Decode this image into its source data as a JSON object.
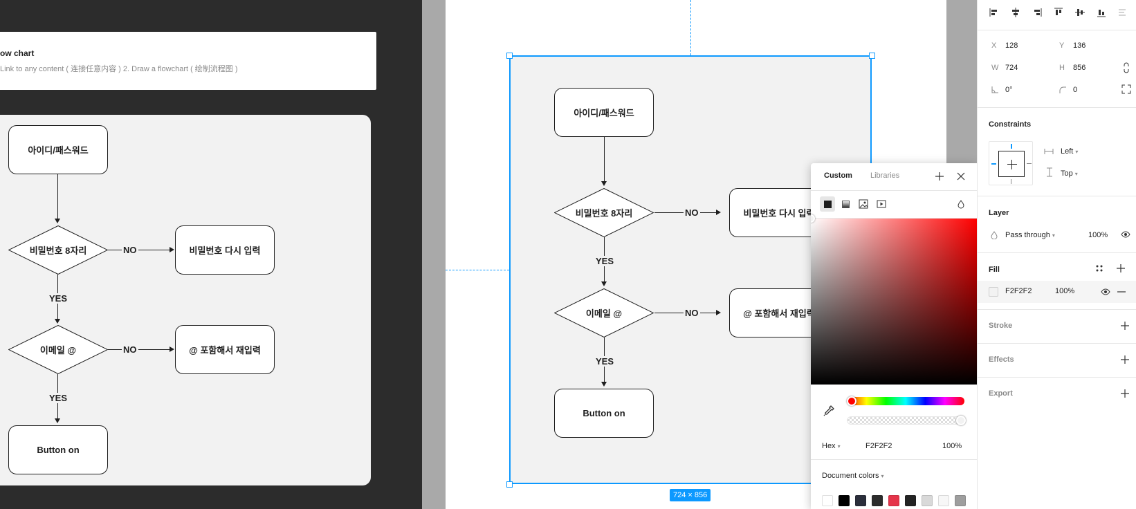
{
  "left_canvas": {
    "note_title": "ow chart",
    "note_subtitle": "Link to any content ( 连接任意内容 ) 2. Draw a flowchart ( 绘制流程图 )"
  },
  "flowchart": {
    "node_id_password": "아이디/패스워드",
    "node_pw_check": "비밀번호 8자리",
    "node_pw_retry": "비밀번호 다시 입력",
    "node_email_check": "이메일 @",
    "node_email_retry": "@ 포함해서 재입력",
    "node_button_on": "Button on",
    "label_no": "NO",
    "label_yes": "YES"
  },
  "selection": {
    "size_label": "724 × 856"
  },
  "color_picker": {
    "tab_custom": "Custom",
    "tab_libraries": "Libraries",
    "mode": "Hex",
    "hex_value": "F2F2F2",
    "opacity": "100%",
    "document_colors_label": "Document colors",
    "document_colors": [
      "#ffffff",
      "#000000",
      "#2b2e3b",
      "#2c2c2c",
      "#e5344a",
      "#232323",
      "#d9d9d9",
      "#f7f7f7",
      "#9e9e9e"
    ],
    "icons": [
      "solid-fill-icon",
      "gradient-fill-icon",
      "image-fill-icon",
      "video-fill-icon",
      "blend-mode-icon",
      "plus-icon",
      "close-icon",
      "eyedropper-icon"
    ]
  },
  "properties": {
    "x_label": "X",
    "x_value": "128",
    "y_label": "Y",
    "y_value": "136",
    "w_label": "W",
    "w_value": "724",
    "h_label": "H",
    "h_value": "856",
    "rotation_value": "0°",
    "corner_radius_value": "0",
    "constraints_title": "Constraints",
    "constraint_horizontal": "Left",
    "constraint_vertical": "Top",
    "layer_title": "Layer",
    "layer_blend": "Pass through",
    "layer_opacity": "100%",
    "fill_title": "Fill",
    "fill_hex": "F2F2F2",
    "fill_opacity": "100%",
    "stroke_title": "Stroke",
    "effects_title": "Effects",
    "export_title": "Export"
  },
  "colors": {
    "selection_blue": "#0d99ff",
    "frame_fill": "#F2F2F2",
    "dark_canvas": "#2c2c2c"
  }
}
